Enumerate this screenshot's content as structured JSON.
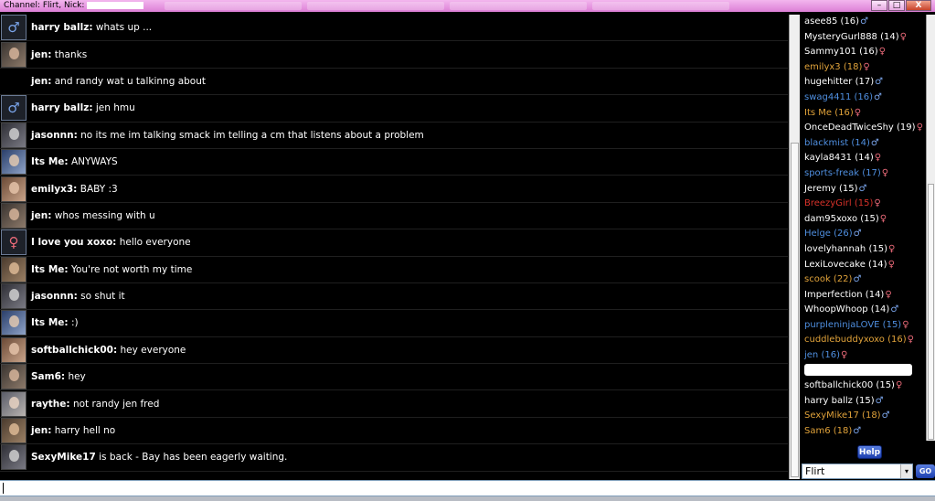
{
  "window": {
    "title": "Channel: Flirt, Nick:",
    "controls": {
      "minimize": "–",
      "maximize": "□",
      "close": "X"
    }
  },
  "messages": [
    {
      "nick": "harry ballz:",
      "text": "whats up ...",
      "avatar": "male"
    },
    {
      "nick": "jen:",
      "text": "thanks",
      "avatar": "photo"
    },
    {
      "nick": "jen:",
      "text": "and randy wat u talkinng about",
      "avatar": "none"
    },
    {
      "nick": "harry ballz:",
      "text": "jen hmu",
      "avatar": "male"
    },
    {
      "nick": "jasonnn:",
      "text": "no its me im talking smack im telling a cm that listens about a problem",
      "avatar": "photo"
    },
    {
      "nick": "Its Me:",
      "text": "ANYWAYS",
      "avatar": "photo"
    },
    {
      "nick": "emilyx3:",
      "text": "BABY :3",
      "avatar": "photo"
    },
    {
      "nick": "jen:",
      "text": "whos messing with u",
      "avatar": "photo"
    },
    {
      "nick": "I love you xoxo:",
      "text": "hello everyone",
      "avatar": "female"
    },
    {
      "nick": "Its Me:",
      "text": "You're not worth my time",
      "avatar": "photo"
    },
    {
      "nick": "jasonnn:",
      "text": "so shut it",
      "avatar": "photo"
    },
    {
      "nick": "Its Me:",
      "text": ":)",
      "avatar": "photo"
    },
    {
      "nick": "softballchick00:",
      "text": "hey everyone",
      "avatar": "photo"
    },
    {
      "nick": "Sam6:",
      "text": "hey",
      "avatar": "photo"
    },
    {
      "nick": "raythe:",
      "text": "not randy jen fred",
      "avatar": "photo"
    },
    {
      "nick": "jen:",
      "text": "harry hell no",
      "avatar": "photo"
    },
    {
      "nick": "SexyMike17",
      "text": "is back - Bay has been eagerly waiting.",
      "avatar": "photo"
    }
  ],
  "users": [
    {
      "label": "asee85 (16)",
      "gender": "m",
      "color": "#ffffff"
    },
    {
      "label": "MysteryGurl888 (14)",
      "gender": "f",
      "color": "#ffffff"
    },
    {
      "label": "Sammy101 (16)",
      "gender": "f",
      "color": "#ffffff"
    },
    {
      "label": "emilyx3 (18)",
      "gender": "f",
      "color": "#e0a23a"
    },
    {
      "label": "hugehitter (17)",
      "gender": "m",
      "color": "#ffffff"
    },
    {
      "label": "swag4411 (16)",
      "gender": "m",
      "color": "#4f8fe0"
    },
    {
      "label": "Its Me (16)",
      "gender": "f",
      "color": "#e0a23a"
    },
    {
      "label": "OnceDeadTwiceShy (19)",
      "gender": "f",
      "color": "#ffffff"
    },
    {
      "label": "blackmist (14)",
      "gender": "m",
      "color": "#4f8fe0"
    },
    {
      "label": "kayla8431 (14)",
      "gender": "f",
      "color": "#ffffff"
    },
    {
      "label": "sports-freak (17)",
      "gender": "f",
      "color": "#4f8fe0"
    },
    {
      "label": "Jeremy (15)",
      "gender": "m",
      "color": "#ffffff"
    },
    {
      "label": "BreezyGirl (15)",
      "gender": "f",
      "color": "#d8322a"
    },
    {
      "label": "dam95xoxo (15)",
      "gender": "f",
      "color": "#ffffff"
    },
    {
      "label": "Helge (26)",
      "gender": "m",
      "color": "#4f8fe0"
    },
    {
      "label": "lovelyhannah (15)",
      "gender": "f",
      "color": "#ffffff"
    },
    {
      "label": "LexiLovecake (14)",
      "gender": "f",
      "color": "#ffffff"
    },
    {
      "label": "scook (22)",
      "gender": "m",
      "color": "#e0a23a"
    },
    {
      "label": "Imperfection (14)",
      "gender": "f",
      "color": "#ffffff"
    },
    {
      "label": "WhoopWhoop (14)",
      "gender": "m",
      "color": "#ffffff"
    },
    {
      "label": "purpleninjaLOVE (15)",
      "gender": "f",
      "color": "#4f8fe0"
    },
    {
      "label": "cuddlebuddyxoxo (16)",
      "gender": "f",
      "color": "#e0a23a"
    },
    {
      "label": "jen (16)",
      "gender": "f",
      "color": "#4f8fe0"
    },
    {
      "label": "",
      "gender": "",
      "color": "#ffffff",
      "redacted": true
    },
    {
      "label": "softballchick00 (15)",
      "gender": "f",
      "color": "#ffffff"
    },
    {
      "label": "harry ballz (15)",
      "gender": "m",
      "color": "#ffffff"
    },
    {
      "label": "SexyMike17 (18)",
      "gender": "m",
      "color": "#e0a23a"
    },
    {
      "label": "Sam6 (18)",
      "gender": "m",
      "color": "#e0a23a"
    }
  ],
  "gender_symbols": {
    "m": "♂",
    "f": "♀"
  },
  "controls": {
    "help_label": "Help",
    "channel_value": "Flirt",
    "go_label": "GO",
    "dropdown_arrow": "▾"
  },
  "input": {
    "value": ""
  },
  "icons": {
    "male": "male-icon",
    "female": "female-icon"
  }
}
